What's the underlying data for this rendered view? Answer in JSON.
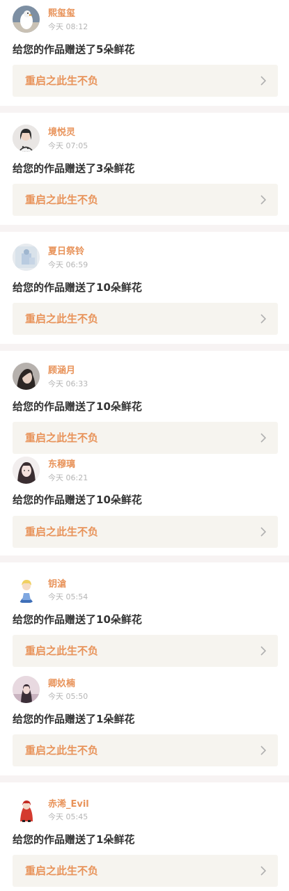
{
  "colors": {
    "accent": "#e8935a",
    "card_link_bg": "#f6f4ef",
    "text": "#333333",
    "time": "#b5b5b5",
    "divider": "#f7f3f3"
  },
  "feed": [
    {
      "user": "熙玺玺",
      "time": "今天 08:12",
      "message": "给您的作品赠送了5朵鲜花",
      "work": "重启之此生不负",
      "avatar": "bird-photo"
    },
    {
      "user": "境悦灵",
      "time": "今天 07:05",
      "message": "给您的作品赠送了3朵鲜花",
      "work": "重启之此生不负",
      "avatar": "girl-photo"
    },
    {
      "user": "夏日祭铃",
      "time": "今天 06:59",
      "message": "给您的作品赠送了10朵鲜花",
      "work": "重启之此生不负",
      "avatar": "blue-photo"
    },
    {
      "user": "顾涵月",
      "time": "今天 06:33",
      "message": "给您的作品赠送了10朵鲜花",
      "work": "重启之此生不负",
      "avatar": "dark-hair-photo"
    },
    {
      "user": "东穆璃",
      "time": "今天 06:21",
      "message": "给您的作品赠送了10朵鲜花",
      "work": "重启之此生不负",
      "avatar": "portrait-photo"
    },
    {
      "user": "钥滄",
      "time": "今天 05:54",
      "message": "给您的作品赠送了10朵鲜花",
      "work": "重启之此生不负",
      "avatar": "anime-photo"
    },
    {
      "user": "卿奺楠",
      "time": "今天 05:50",
      "message": "给您的作品赠送了1朵鲜花",
      "work": "重启之此生不负",
      "avatar": "pink-photo"
    },
    {
      "user": "赤浠_Evil",
      "time": "今天 05:45",
      "message": "给您的作品赠送了1朵鲜花",
      "work": "重启之此生不负",
      "avatar": "red-figure-photo"
    }
  ]
}
